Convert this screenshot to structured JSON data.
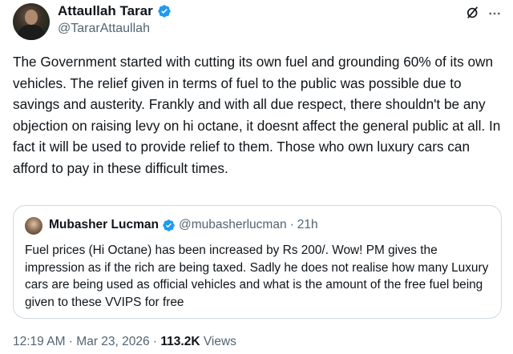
{
  "author": {
    "display_name": "Attaullah Tarar",
    "handle": "@TararAttaullah",
    "verified_color": "#1d9bf0"
  },
  "tweet": {
    "text": "The Government started with cutting its own fuel and grounding 60% of its own vehicles. The relief given in terms of fuel to the public was possible due to savings and austerity. Frankly and with all due respect, there shouldn't be any objection on raising levy on hi octane, it doesnt affect the general public at all. In fact it will be used to provide relief to them. Those who own luxury cars can afford to pay in these difficult times."
  },
  "quoted_tweet": {
    "display_name": "Mubasher Lucman",
    "handle": "@mubasherlucman",
    "separator": "·",
    "time": "21h",
    "text": "Fuel prices (Hi Octane) has been increased by Rs 200/. Wow! PM gives the impression as if the rich are being taxed. Sadly he does not realise how many Luxury cars are being used as official vehicles and what is the amount of the free fuel being given to these VVIPS for free"
  },
  "meta": {
    "time": "12:19 AM",
    "separator1": " · ",
    "date": "Mar 23, 2026",
    "separator2": " · ",
    "views_count": "113.2K",
    "views_label": " Views"
  },
  "icons": {
    "verified": "verified-badge-icon",
    "grok": "grok-icon",
    "more": "more-icon"
  },
  "colors": {
    "text_primary": "#0f1419",
    "text_secondary": "#536471",
    "border": "#cfd9de",
    "verified": "#1d9bf0"
  }
}
